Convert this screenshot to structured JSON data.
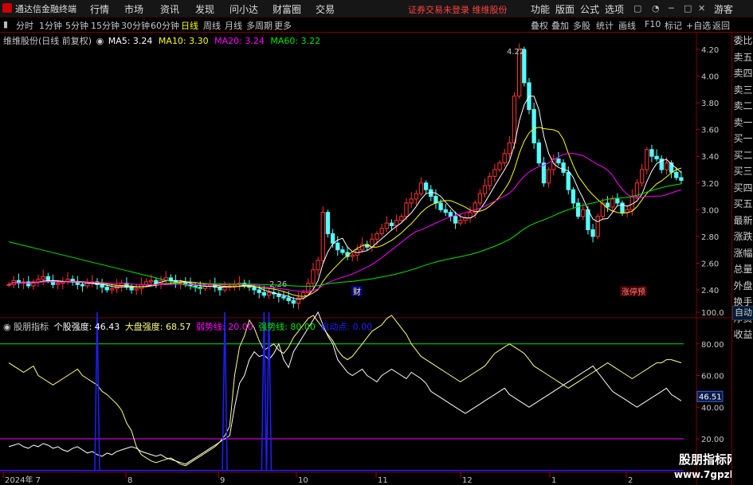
{
  "app": {
    "title": "通达信金融终端"
  },
  "menu": [
    "行情",
    "市场",
    "资讯",
    "发现",
    "问小达",
    "财富圈",
    "交易"
  ],
  "notice": "证券交易未登录  维维股份",
  "right_menu": [
    "功能",
    "版面",
    "公式",
    "选项"
  ],
  "user_label": "游客",
  "periods": [
    "分时",
    "1分钟",
    "5分钟",
    "15分钟",
    "30分钟",
    "60分钟",
    "日线",
    "周线",
    "月线",
    "多周期",
    "更多"
  ],
  "active_period": "日线",
  "toolbar": [
    "叠权",
    "叠加",
    "多股",
    "统计",
    "画线",
    "F10",
    "标记",
    "+自选",
    "返回"
  ],
  "sidebar": [
    "委比",
    "卖五",
    "卖四",
    "卖三",
    "卖二",
    "卖一",
    "买一",
    "买二",
    "买三",
    "买四",
    "买五",
    "最新",
    "涨跌",
    "涨幅",
    "总量",
    "外盘",
    "换手",
    "净资",
    "收益"
  ],
  "auto_label": "自动",
  "main_legend": {
    "title": "维维股份(日线 前复权)",
    "ma5": "MA5: 3.24",
    "ma10": "MA10: 3.30",
    "ma20": "MA20: 3.24",
    "ma60": "MA60: 3.22"
  },
  "sub_legend": {
    "name": "股朋指标",
    "l1": "个股强度: 46.43",
    "l2": "大盘强度: 68.57",
    "l3": "弱势线: 20.00",
    "l4": "强势线: 80.00",
    "l5": "启动点: 0.00"
  },
  "price_axis": [
    "4.20",
    "4.00",
    "3.80",
    "3.60",
    "3.40",
    "3.20",
    "3.00",
    "2.80",
    "2.60",
    "2.40"
  ],
  "ind_axis": [
    "100.0",
    "80.00",
    "60.00",
    "40.00",
    "20.00"
  ],
  "ind_current": "46.51",
  "annotations": {
    "high": "4.22",
    "low": "2.26",
    "cai": "财",
    "zhangting": "涨停预"
  },
  "x_labels": [
    "2024年 7",
    "8",
    "9",
    "10",
    "11",
    "12",
    "1",
    "2"
  ],
  "watermark_lines": [
    "股朋指标网",
    "www.7gpzb.com"
  ],
  "colors": {
    "up": "#ff3232",
    "down": "#54ffff",
    "ma5": "#ffffff",
    "ma10": "#ffff00",
    "ma20": "#ff00ff",
    "ma60": "#00e600",
    "ind_stock": "#ffffff",
    "ind_market": "#ffff80",
    "weak": "#ff00ff",
    "strong": "#00e600",
    "start": "#2020ff"
  },
  "chart_data": {
    "type": "candlestick",
    "price_range": [
      2.26,
      4.22
    ],
    "ind_range": [
      0,
      100
    ],
    "close": [
      2.44,
      2.47,
      2.45,
      2.46,
      2.43,
      2.46,
      2.48,
      2.5,
      2.47,
      2.44,
      2.45,
      2.46,
      2.48,
      2.46,
      2.44,
      2.43,
      2.45,
      2.46,
      2.44,
      2.42,
      2.4,
      2.41,
      2.43,
      2.45,
      2.42,
      2.4,
      2.41,
      2.44,
      2.46,
      2.47,
      2.45,
      2.47,
      2.49,
      2.47,
      2.45,
      2.46,
      2.44,
      2.43,
      2.42,
      2.41,
      2.43,
      2.44,
      2.42,
      2.4,
      2.42,
      2.43,
      2.44,
      2.45,
      2.43,
      2.42,
      2.4,
      2.38,
      2.36,
      2.38,
      2.37,
      2.35,
      2.34,
      2.32,
      2.3,
      2.34,
      2.38,
      2.45,
      2.55,
      2.62,
      2.98,
      2.82,
      2.75,
      2.7,
      2.68,
      2.65,
      2.66,
      2.7,
      2.74,
      2.72,
      2.78,
      2.82,
      2.86,
      2.9,
      2.88,
      2.92,
      2.95,
      3.05,
      3.08,
      3.12,
      3.2,
      3.15,
      3.1,
      3.05,
      3.0,
      2.98,
      2.95,
      2.9,
      2.92,
      2.94,
      2.98,
      3.05,
      3.12,
      3.18,
      3.25,
      3.3,
      3.35,
      3.42,
      3.5,
      3.85,
      4.2,
      3.95,
      3.75,
      3.5,
      3.35,
      3.2,
      3.3,
      3.38,
      3.35,
      3.28,
      3.15,
      3.05,
      2.95,
      3.0,
      2.85,
      2.8,
      2.95,
      3.05,
      3.02,
      3.08,
      3.05,
      2.98,
      3.0,
      3.1,
      3.2,
      3.3,
      3.45,
      3.4,
      3.38,
      3.3,
      3.35,
      3.28,
      3.24,
      3.22
    ],
    "ind_stock": [
      15,
      16,
      17,
      15,
      14,
      16,
      15,
      17,
      16,
      14,
      15,
      13,
      12,
      14,
      15,
      13,
      11,
      12,
      10,
      9,
      11,
      10,
      12,
      13,
      14,
      15,
      14,
      12,
      11,
      10,
      9,
      10,
      8,
      7,
      6,
      5,
      4,
      6,
      8,
      10,
      12,
      14,
      16,
      18,
      20,
      22,
      40,
      55,
      60,
      70,
      75,
      72,
      73,
      70,
      74,
      80,
      70,
      65,
      75,
      80,
      85,
      90,
      95,
      100,
      92,
      85,
      80,
      70,
      66,
      62,
      60,
      62,
      64,
      60,
      58,
      56,
      60,
      62,
      64,
      62,
      60,
      58,
      62,
      60,
      58,
      55,
      50,
      48,
      46,
      44,
      42,
      40,
      38,
      36,
      38,
      40,
      42,
      44,
      46,
      48,
      50,
      52,
      48,
      46,
      44,
      42,
      40,
      42,
      44,
      46,
      48,
      50,
      52,
      54,
      56,
      58,
      60,
      62,
      64,
      66,
      62,
      58,
      54,
      50,
      48,
      46,
      44,
      42,
      40,
      42,
      44,
      46,
      48,
      50,
      52,
      48,
      46,
      44
    ],
    "ind_market": [
      68,
      66,
      64,
      62,
      64,
      66,
      60,
      58,
      56,
      54,
      56,
      58,
      60,
      62,
      64,
      60,
      58,
      56,
      54,
      50,
      48,
      45,
      42,
      38,
      30,
      25,
      15,
      10,
      8,
      6,
      5,
      6,
      7,
      8,
      6,
      4,
      3,
      5,
      7,
      9,
      11,
      13,
      15,
      18,
      22,
      28,
      60,
      78,
      85,
      95,
      90,
      82,
      76,
      78,
      80,
      76,
      74,
      78,
      84,
      88,
      92,
      96,
      98,
      94,
      90,
      86,
      82,
      76,
      72,
      70,
      72,
      76,
      80,
      84,
      88,
      90,
      92,
      96,
      98,
      94,
      90,
      86,
      80,
      76,
      72,
      70,
      68,
      66,
      64,
      62,
      60,
      58,
      56,
      58,
      60,
      62,
      64,
      66,
      70,
      74,
      76,
      78,
      80,
      78,
      76,
      74,
      70,
      66,
      64,
      62,
      60,
      58,
      56,
      54,
      52,
      54,
      56,
      58,
      60,
      62,
      64,
      66,
      68,
      66,
      64,
      62,
      60,
      58,
      60,
      62,
      64,
      66,
      68,
      68,
      70,
      70,
      69,
      68
    ],
    "start_signals": [
      18,
      44,
      52,
      53
    ]
  }
}
